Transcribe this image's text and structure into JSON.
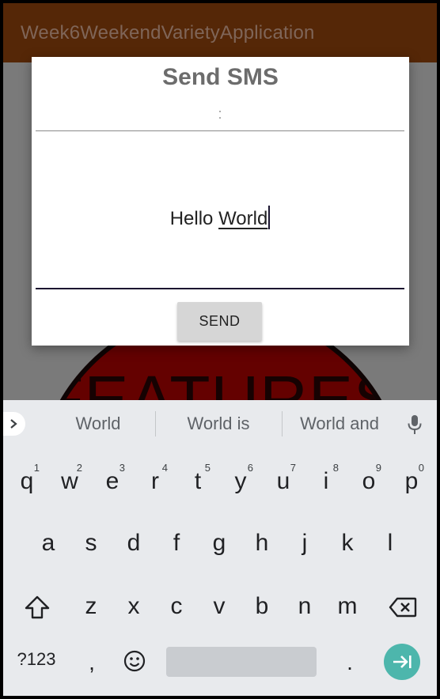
{
  "app": {
    "title": "Week6WeekendVarietyApplication",
    "background_logo_text": "FEATURES"
  },
  "dialog": {
    "title": "Send SMS",
    "phone_value": ":",
    "message_words": [
      "Hello",
      "World"
    ],
    "send_label": "SEND"
  },
  "keyboard": {
    "suggestions": [
      "World",
      "World is",
      "World and"
    ],
    "row1": [
      {
        "label": "q",
        "hint": "1"
      },
      {
        "label": "w",
        "hint": "2"
      },
      {
        "label": "e",
        "hint": "3"
      },
      {
        "label": "r",
        "hint": "4"
      },
      {
        "label": "t",
        "hint": "5"
      },
      {
        "label": "y",
        "hint": "6"
      },
      {
        "label": "u",
        "hint": "7"
      },
      {
        "label": "i",
        "hint": "8"
      },
      {
        "label": "o",
        "hint": "9"
      },
      {
        "label": "p",
        "hint": "0"
      }
    ],
    "row2": [
      "a",
      "s",
      "d",
      "f",
      "g",
      "h",
      "j",
      "k",
      "l"
    ],
    "row3": [
      "z",
      "x",
      "c",
      "v",
      "b",
      "n",
      "m"
    ],
    "symbols_label": "?123",
    "comma_label": ",",
    "period_label": "."
  },
  "colors": {
    "app_bar": "#552707",
    "enter_key": "#4db6ac",
    "keyboard_bg": "#e8eaed"
  },
  "icons": {
    "expand": "chevron-right-icon",
    "mic": "mic-icon",
    "shift": "shift-icon",
    "backspace": "backspace-icon",
    "emoji": "emoji-icon",
    "enter": "enter-arrow-icon"
  }
}
